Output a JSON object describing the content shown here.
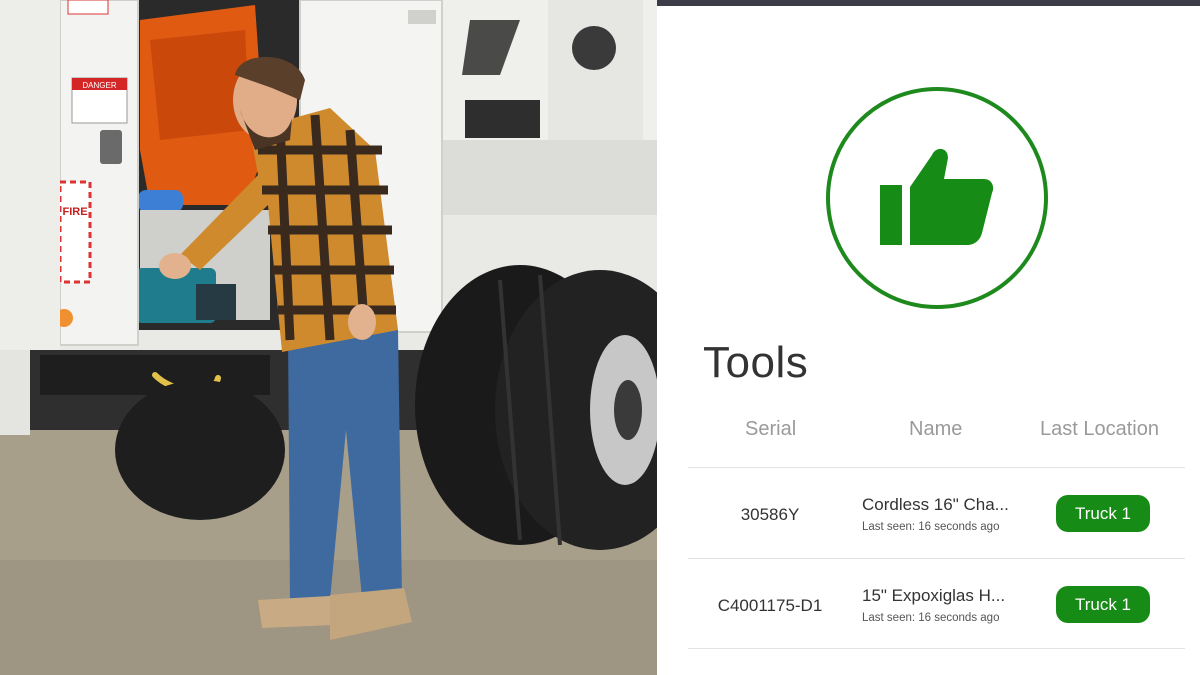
{
  "panel": {
    "status_icon": "thumbs-up-icon",
    "accent_color": "#168c16",
    "section_title": "Tools"
  },
  "table": {
    "columns": [
      "Serial",
      "Name",
      "Last Location"
    ],
    "rows": [
      {
        "serial": "30586Y",
        "name": "Cordless 16\" Cha...",
        "last_seen": "Last seen: 16 seconds ago",
        "location": "Truck 1"
      },
      {
        "serial": "C4001175-D1",
        "name": "15\" Expoxiglas H...",
        "last_seen": "Last seen: 16 seconds ago",
        "location": "Truck 1"
      }
    ]
  },
  "photo": {
    "sticker_danger": "DANGER",
    "sticker_fire": "FIRE"
  }
}
